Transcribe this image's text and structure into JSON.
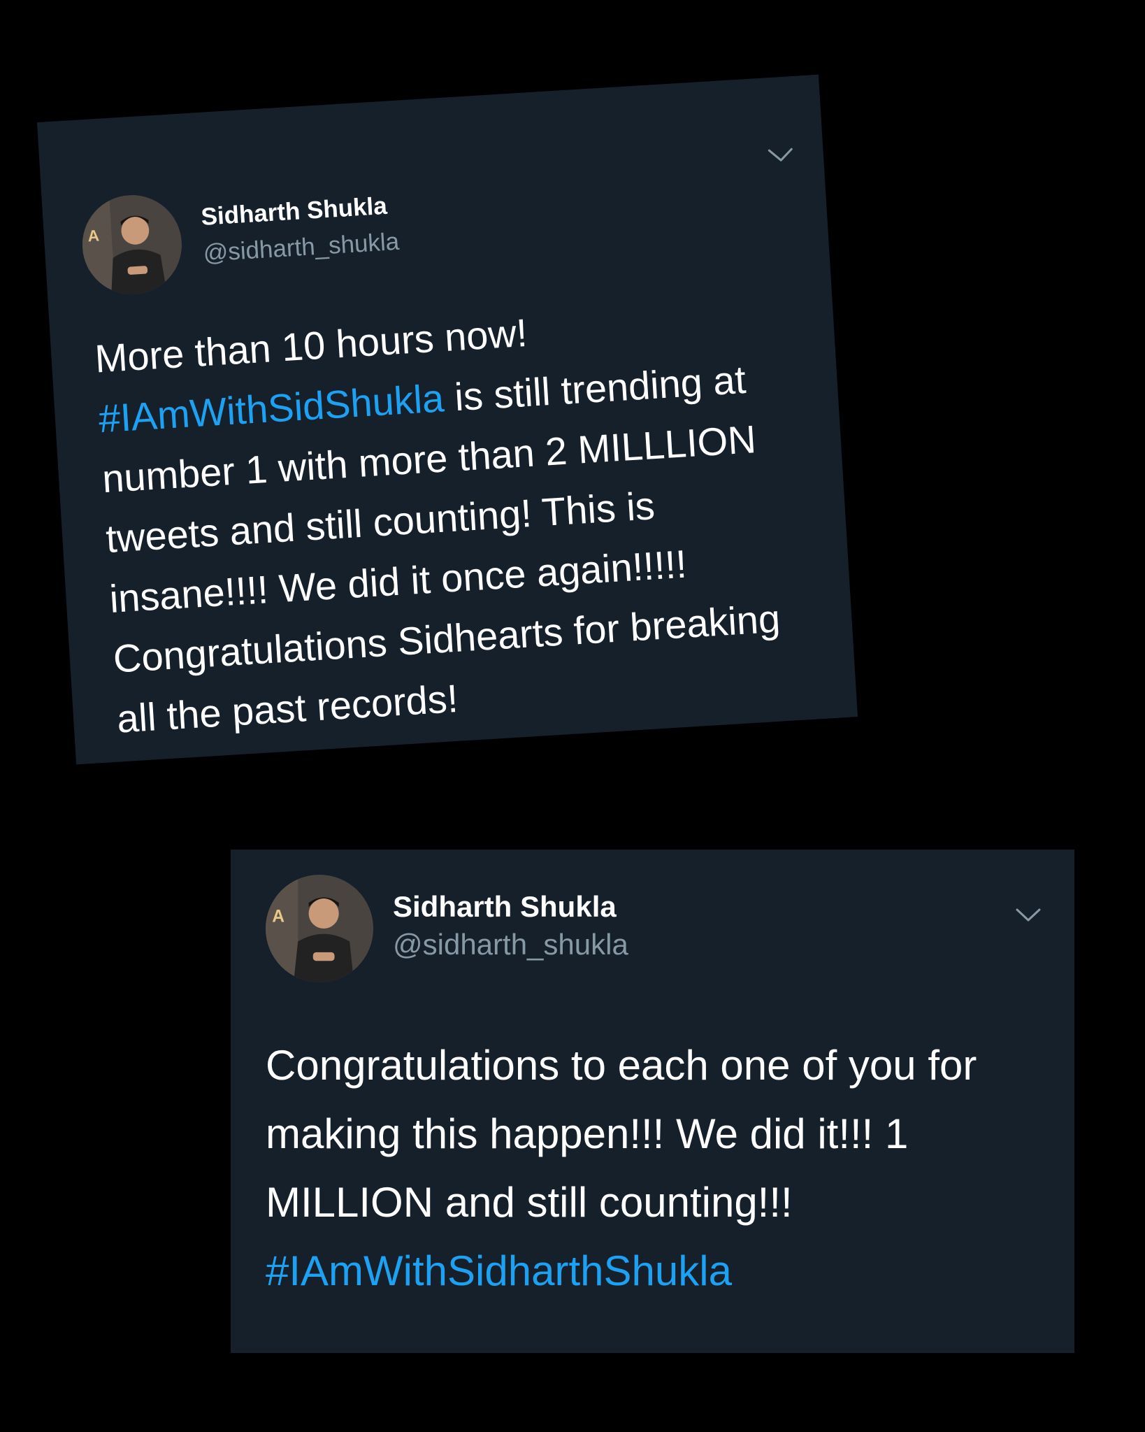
{
  "tweets": [
    {
      "author_name": "Sidharth Shukla",
      "author_handle": "@sidharth_shukla",
      "avatar_icon": "profile-photo",
      "menu_icon": "chevron-down-icon",
      "text_before": "More than 10 hours now!",
      "hashtag": "#IAmWithSidShukla",
      "text_after": " is still trending at number 1 with more than 2 MILLLION tweets and still counting! This is insane!!!! We did it once again!!!!! Congratulations Sidhearts for breaking all the past records!"
    },
    {
      "author_name": "Sidharth Shukla",
      "author_handle": "@sidharth_shukla",
      "avatar_icon": "profile-photo",
      "menu_icon": "chevron-down-icon",
      "text_before": "Congratulations to each one of you for making this happen!!! We did it!!! 1 MILLION and still counting!!!",
      "hashtag": "#IAmWithSidharthShukla",
      "text_after": ""
    }
  ],
  "colors": {
    "background": "#000000",
    "card": "#15202b",
    "text": "#ffffff",
    "secondary": "#8899a6",
    "link": "#1da1f2"
  }
}
